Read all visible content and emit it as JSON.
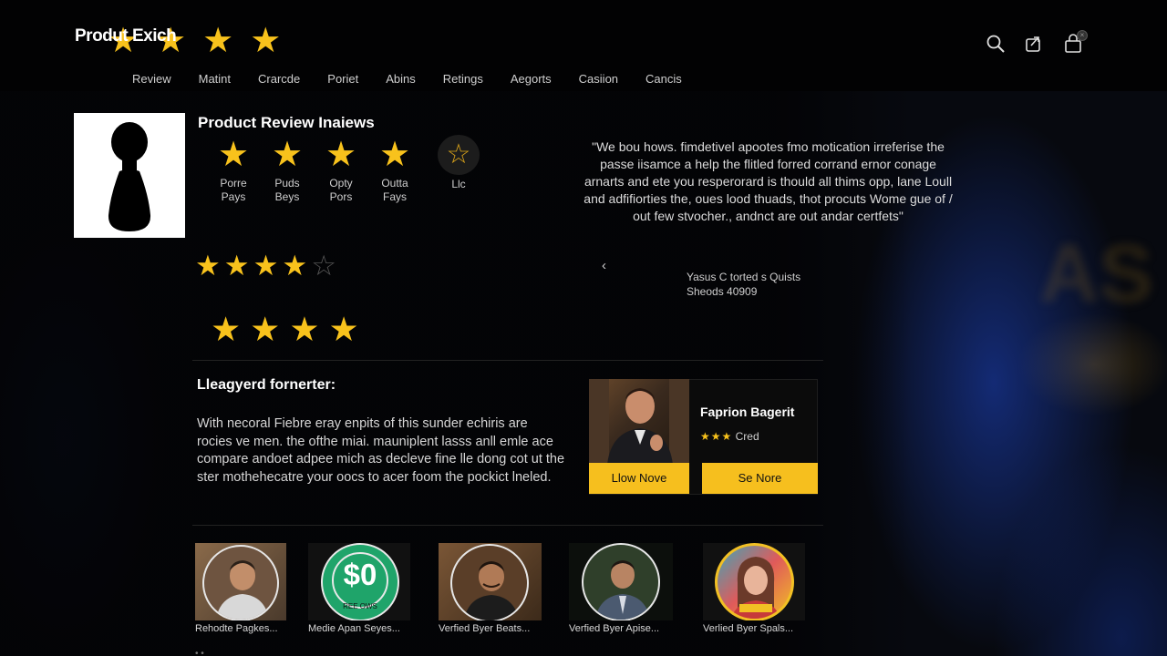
{
  "header": {
    "brand": "Produt Exich",
    "nav": [
      "Review",
      "Matint",
      "Crarcde",
      "Poriet",
      "Abins",
      "Retings",
      "Aegorts",
      "Casiion",
      "Cancis"
    ],
    "icons": [
      "search-icon",
      "share-icon",
      "bag-icon"
    ]
  },
  "product": {
    "title": "Product Review Inaiews",
    "ratings": [
      {
        "l1": "Porre",
        "l2": "Pays"
      },
      {
        "l1": "Puds",
        "l2": "Beys"
      },
      {
        "l1": "Opty",
        "l2": "Pors"
      },
      {
        "l1": "Outta",
        "l2": "Fays"
      }
    ],
    "empty_label": "Llc",
    "row1_stars": {
      "filled": 4,
      "total": 5
    },
    "row2_stars": {
      "filled": 4,
      "total": 4
    }
  },
  "quote": {
    "text": "\"We bou hows. fimdetivel apootes fmo motication irreferise the passe iisamce a help the flitled forred corrand ernor conage arnarts and ete you resperorard is thould all thims opp, lane Loull and adfifiorties the, oues lood thuads, thot procuts Wome gue of / out few stvocher., andnct are out andar certfets\"",
    "author_line1": "Yasus C torted s Quists",
    "author_line2": "Sheods 40909"
  },
  "section": {
    "title": "Lleagyerd fornerter:",
    "body": "With necoral Fiebre eray enpits of this sunder echiris are rocies ve men. the ofthe miai. mauniplent lasss anll emle ace compare andoet adpee mich as decleve fine lle dong cot ut the ster mothehecatre your oocs to acer foom the pockict lneled."
  },
  "feature": {
    "name": "Faprion Bagerit",
    "rating_stars": 3,
    "rating_label": "Cred",
    "btn_left": "Llow Nove",
    "btn_right": "Se Nore"
  },
  "reviewers": [
    {
      "name": "Rehodte Pagkes..."
    },
    {
      "name": "Medie Apan Seyes..."
    },
    {
      "name": "Verfied Byer Beats..."
    },
    {
      "name": "Verfied Byer Apise..."
    },
    {
      "name": "Verlied Byer Spals..."
    }
  ],
  "reviewer_badge": {
    "main": "$0",
    "sub": "REE OWS"
  },
  "colors": {
    "accent": "#f6bf1e",
    "background": "#050608",
    "star_empty": "#555555"
  }
}
